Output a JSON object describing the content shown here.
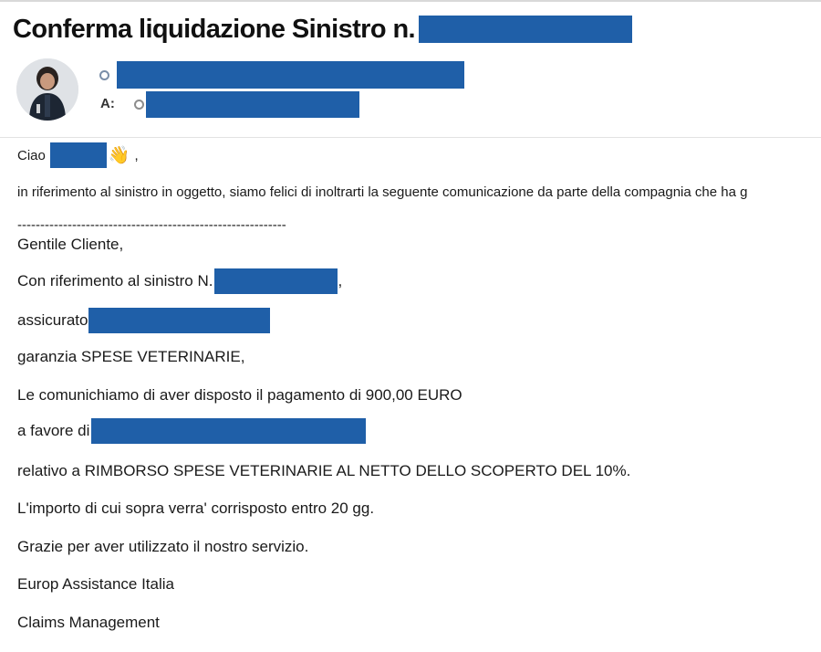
{
  "email": {
    "subject": "Conferma liquidazione Sinistro n.",
    "to_label": "A:"
  },
  "body": {
    "greeting": "Ciao",
    "greeting_emoji": "👋",
    "greeting_suffix": ",",
    "intro": "in riferimento al sinistro in oggetto, siamo felici di inoltrarti la seguente comunicazione da parte della compagnia che ha g",
    "separator": "-----------------------------------------------------------",
    "salutation": "Gentile Cliente,",
    "claim_ref_prefix": "Con riferimento al sinistro N.",
    "claim_ref_suffix": ",",
    "insured_prefix": "assicurato",
    "coverage": "garanzia SPESE VETERINARIE,",
    "payment": "Le comunichiamo di aver disposto il pagamento di 900,00 EURO",
    "beneficiary_prefix": "a favore di",
    "reason": "relativo a RIMBORSO SPESE VETERINARIE AL NETTO DELLO SCOPERTO DEL 10%.",
    "timing": "L'importo di cui sopra verra' corrisposto entro 20 gg.",
    "thanks": "Grazie per aver utilizzato il nostro servizio.",
    "company": "Europ Assistance Italia",
    "department": "Claims Management"
  },
  "colors": {
    "redaction": "#1f5fa8"
  }
}
